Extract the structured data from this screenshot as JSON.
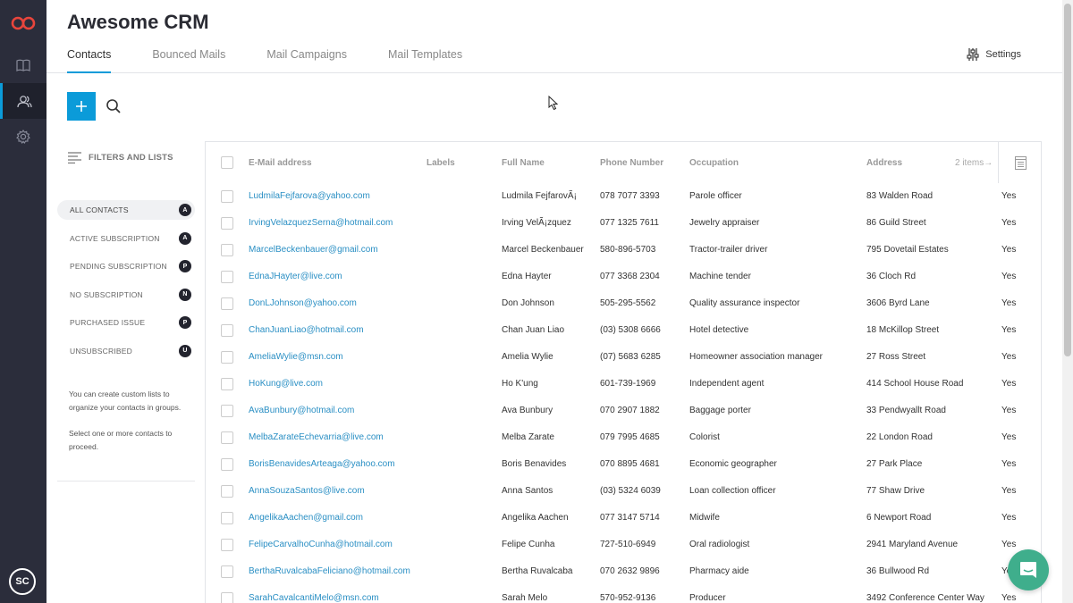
{
  "app": {
    "title": "Awesome CRM",
    "user_initials": "SC"
  },
  "colors": {
    "accent": "#0b9bd9",
    "rail": "#2b2d3b",
    "logo": "#e8453c",
    "chat": "#3fae8c",
    "link": "#2a8fc4"
  },
  "tabs": [
    {
      "label": "Contacts",
      "active": true
    },
    {
      "label": "Bounced Mails",
      "active": false
    },
    {
      "label": "Mail Campaigns",
      "active": false
    },
    {
      "label": "Mail Templates",
      "active": false
    }
  ],
  "settings_label": "Settings",
  "sidebar": {
    "header": "FILTERS AND LISTS",
    "filters": [
      {
        "label": "ALL CONTACTS",
        "badge": "A",
        "active": true
      },
      {
        "label": "ACTIVE SUBSCRIPTION",
        "badge": "A",
        "active": false
      },
      {
        "label": "PENDING SUBSCRIPTION",
        "badge": "P",
        "active": false
      },
      {
        "label": "NO SUBSCRIPTION",
        "badge": "N",
        "active": false
      },
      {
        "label": "PURCHASED ISSUE",
        "badge": "P",
        "active": false
      },
      {
        "label": "UNSUBSCRIBED",
        "badge": "U",
        "active": false
      }
    ],
    "help_1": "You can create custom lists to organize your contacts in groups.",
    "help_2": "Select one or more contacts to proceed."
  },
  "table": {
    "columns": [
      "E-Mail address",
      "Labels",
      "Full Name",
      "Phone Number",
      "Occupation",
      "Address"
    ],
    "items_count": "2 items→",
    "rows": [
      {
        "email": "LudmilaFejfarova@yahoo.com",
        "name": "Ludmila FejfarovÃ¡",
        "phone": "078 7077 3393",
        "occupation": "Parole officer",
        "address": "83 Walden Road",
        "extra": "Yes"
      },
      {
        "email": "IrvingVelazquezSerna@hotmail.com",
        "name": "Irving VelÃ¡zquez",
        "phone": "077 1325 7611",
        "occupation": "Jewelry appraiser",
        "address": "86 Guild Street",
        "extra": "Yes"
      },
      {
        "email": "MarcelBeckenbauer@gmail.com",
        "name": "Marcel Beckenbauer",
        "phone": "580-896-5703",
        "occupation": "Tractor-trailer driver",
        "address": "795 Dovetail Estates",
        "extra": "Yes"
      },
      {
        "email": "EdnaJHayter@live.com",
        "name": "Edna Hayter",
        "phone": "077 3368 2304",
        "occupation": "Machine tender",
        "address": "36 Cloch Rd",
        "extra": "Yes"
      },
      {
        "email": "DonLJohnson@yahoo.com",
        "name": "Don Johnson",
        "phone": "505-295-5562",
        "occupation": "Quality assurance inspector",
        "address": "3606 Byrd Lane",
        "extra": "Yes"
      },
      {
        "email": "ChanJuanLiao@hotmail.com",
        "name": "Chan Juan Liao",
        "phone": "(03) 5308 6666",
        "occupation": "Hotel detective",
        "address": "18 McKillop Street",
        "extra": "Yes"
      },
      {
        "email": "AmeliaWylie@msn.com",
        "name": "Amelia Wylie",
        "phone": "(07) 5683 6285",
        "occupation": "Homeowner association manager",
        "address": "27 Ross Street",
        "extra": "Yes"
      },
      {
        "email": "HoKung@live.com",
        "name": "Ho K'ung",
        "phone": "601-739-1969",
        "occupation": "Independent agent",
        "address": "414 School House Road",
        "extra": "Yes"
      },
      {
        "email": "AvaBunbury@hotmail.com",
        "name": "Ava Bunbury",
        "phone": "070 2907 1882",
        "occupation": "Baggage porter",
        "address": "33 Pendwyallt Road",
        "extra": "Yes"
      },
      {
        "email": "MelbaZarateEchevarria@live.com",
        "name": "Melba Zarate",
        "phone": "079 7995 4685",
        "occupation": "Colorist",
        "address": "22 London Road",
        "extra": "Yes"
      },
      {
        "email": "BorisBenavidesArteaga@yahoo.com",
        "name": "Boris Benavides",
        "phone": "070 8895 4681",
        "occupation": "Economic geographer",
        "address": "27 Park Place",
        "extra": "Yes"
      },
      {
        "email": "AnnaSouzaSantos@live.com",
        "name": "Anna Santos",
        "phone": "(03) 5324 6039",
        "occupation": "Loan collection officer",
        "address": "77 Shaw Drive",
        "extra": "Yes"
      },
      {
        "email": "AngelikaAachen@gmail.com",
        "name": "Angelika Aachen",
        "phone": "077 3147 5714",
        "occupation": "Midwife",
        "address": "6 Newport Road",
        "extra": "Yes"
      },
      {
        "email": "FelipeCarvalhoCunha@hotmail.com",
        "name": "Felipe Cunha",
        "phone": "727-510-6949",
        "occupation": "Oral radiologist",
        "address": "2941 Maryland Avenue",
        "extra": "Yes"
      },
      {
        "email": "BerthaRuvalcabaFeliciano@hotmail.com",
        "name": "Bertha Ruvalcaba",
        "phone": "070 2632 9896",
        "occupation": "Pharmacy aide",
        "address": "36 Bullwood Rd",
        "extra": "Ye"
      },
      {
        "email": "SarahCavalcantiMelo@msn.com",
        "name": "Sarah Melo",
        "phone": "570-952-9136",
        "occupation": "Producer",
        "address": "3492 Conference Center Way",
        "extra": "Yes"
      }
    ]
  },
  "icons": {
    "logo": "infinity-logo-icon",
    "nav": [
      "book-icon",
      "users-icon",
      "gear-icon"
    ],
    "add": "plus-icon",
    "search": "search-icon",
    "settings": "sliders-icon",
    "columns": "columns-icon",
    "chat": "chat-icon"
  }
}
